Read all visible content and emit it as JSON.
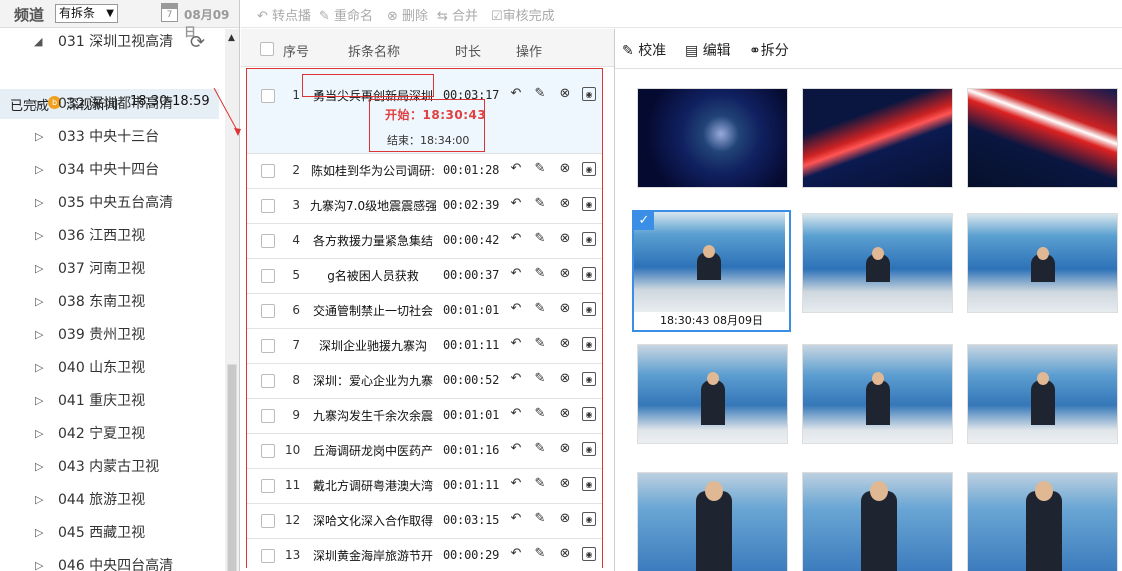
{
  "left": {
    "title": "频道",
    "filter": "有拆条",
    "filter_arrow": "▼",
    "calendar_day": "7",
    "date": "08月09日",
    "top_item": "031 深圳卫视高清",
    "done_label": "已完成",
    "done_badge": "b",
    "program": "深视新闻",
    "program_time": "18:30-18:59",
    "channels": [
      "032 深圳都市高清",
      "033 中央十三台",
      "034 中央十四台",
      "035 中央五台高清",
      "036 江西卫视",
      "037 河南卫视",
      "038 东南卫视",
      "039 贵州卫视",
      "040 山东卫视",
      "041 重庆卫视",
      "042 宁夏卫视",
      "043 内蒙古卫视",
      "044 旅游卫视",
      "045 西藏卫视",
      "046 中央四台高清"
    ]
  },
  "toolbar": {
    "transfer": "转点播",
    "rename": "重命名",
    "delete": "删除",
    "merge": "合并",
    "review": "审核完成"
  },
  "mid": {
    "h_no": "序号",
    "h_name": "拆条名称",
    "h_dur": "时长",
    "h_op": "操作",
    "start": "开始：18:30:43",
    "end": "结束：18:34:00",
    "rows": [
      {
        "n": "1",
        "t": "勇当尖兵再创新局深圳",
        "d": "00:03:17"
      },
      {
        "n": "2",
        "t": "陈如桂到华为公司调研:",
        "d": "00:01:28"
      },
      {
        "n": "3",
        "t": "九寨沟7.0级地震震感强",
        "d": "00:02:39"
      },
      {
        "n": "4",
        "t": "各方救援力量紧急集结",
        "d": "00:00:42"
      },
      {
        "n": "5",
        "t": "g名被困人员获救",
        "d": "00:00:37"
      },
      {
        "n": "6",
        "t": "交通管制禁止一切社会",
        "d": "00:01:01"
      },
      {
        "n": "7",
        "t": "深圳企业驰援九寨沟",
        "d": "00:01:11"
      },
      {
        "n": "8",
        "t": "深圳：爱心企业为九寨",
        "d": "00:00:52"
      },
      {
        "n": "9",
        "t": "九寨沟发生千余次余震",
        "d": "00:01:01"
      },
      {
        "n": "10",
        "t": "丘海调研龙岗中医药产",
        "d": "00:01:16"
      },
      {
        "n": "11",
        "t": "戴北方调研粤港澳大湾",
        "d": "00:01:11"
      },
      {
        "n": "12",
        "t": "深哈文化深入合作取得",
        "d": "00:03:15"
      },
      {
        "n": "13",
        "t": "深圳黄金海岸旅游节开",
        "d": "00:00:29"
      }
    ]
  },
  "right": {
    "calib": "校准",
    "edit": "编辑",
    "split": "拆分",
    "sel_stamp": "18:30:43 08月09日"
  },
  "icons": [
    "undo-icon",
    "edit-icon",
    "delete-icon",
    "record-icon",
    "refresh-icon",
    "calendar-icon",
    "transfer-icon",
    "rename-icon",
    "merge-icon",
    "checkbox-icon",
    "check-icon",
    "scissors-icon"
  ],
  "colors": {
    "accent": "#3a8ee6",
    "highlight": "#d33",
    "badge": "#f0a020",
    "start_text": "#e04040"
  }
}
